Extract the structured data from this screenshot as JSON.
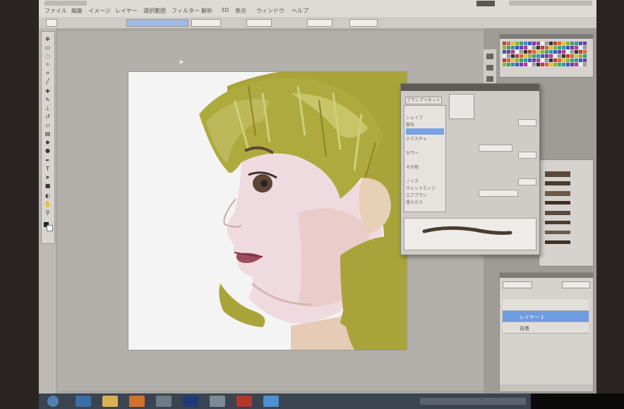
{
  "menubar": {
    "items": [
      "ファイル",
      "編集",
      "イメージ",
      "レイヤー",
      "選択範囲",
      "フィルター",
      "解析",
      "3D",
      "表示",
      "ウィンドウ",
      "ヘルプ"
    ]
  },
  "taskbar": {
    "apps": [
      "start",
      "ie",
      "explorer",
      "media",
      "app",
      "photoshop",
      "app",
      "app",
      "app"
    ]
  },
  "brush_panel": {
    "button": "ブラシプリセット",
    "rows": [
      "",
      "シェイプ",
      "散布",
      "",
      "テクスチャ",
      "",
      "カラー",
      "",
      "その他",
      "",
      "ノイズ",
      "ウェットエッジ",
      "エアブラシ",
      "滑らかさ"
    ]
  },
  "layers_panel": {
    "layers": [
      {
        "label": ""
      },
      {
        "label": "レイヤー 1"
      },
      {
        "label": "背景"
      }
    ]
  },
  "colors": {
    "hair": "#a8a43a",
    "skin": "#efd9dc",
    "lip": "#9b4c5c",
    "select": "#6f9be0"
  }
}
